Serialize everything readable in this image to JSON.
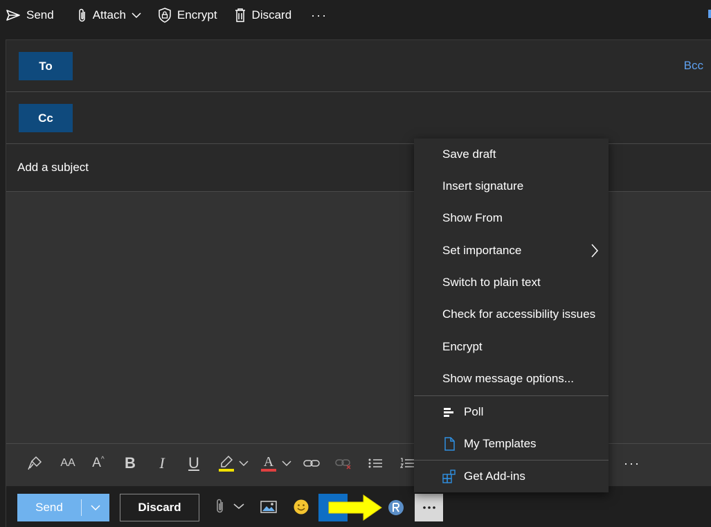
{
  "toolbar": {
    "send": "Send",
    "attach": "Attach",
    "encrypt": "Encrypt",
    "discard": "Discard",
    "more": "···"
  },
  "compose": {
    "to_label": "To",
    "cc_label": "Cc",
    "bcc_label": "Bcc",
    "subject_placeholder": "Add a subject"
  },
  "format_toolbar": {
    "font_size": "AA",
    "grow": "A",
    "bold": "B",
    "italic": "I",
    "underline": "U",
    "highlight_color": "#f0e000",
    "font_color_letter": "A",
    "font_color": "#e04040",
    "more": "···"
  },
  "actions": {
    "send": "Send",
    "discard": "Discard",
    "send_color": "#6fb2ee",
    "arrow_color": "#ffff00"
  },
  "menu": {
    "items": [
      {
        "label": "Save draft"
      },
      {
        "label": "Insert signature"
      },
      {
        "label": "Show From"
      },
      {
        "label": "Set importance"
      },
      {
        "label": "Switch to plain text"
      },
      {
        "label": "Check for accessibility issues"
      },
      {
        "label": "Encrypt"
      },
      {
        "label": "Show message options..."
      }
    ],
    "addins": [
      {
        "label": "Poll",
        "icon": "poll-icon"
      },
      {
        "label": "My Templates",
        "icon": "templates-icon"
      }
    ],
    "get_addins": {
      "label": "Get Add-ins",
      "icon": "get-addins-icon"
    }
  },
  "colors": {
    "accent": "#5ea0ef",
    "recipient_button": "#0f4a7d",
    "background": "#1f1f1f",
    "panel": "#292929"
  }
}
